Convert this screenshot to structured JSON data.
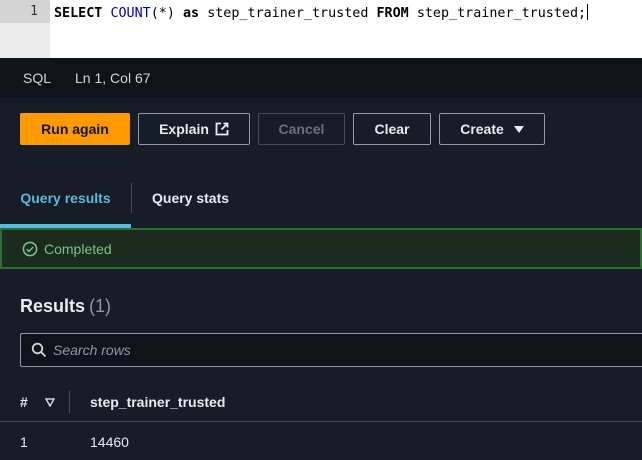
{
  "editor": {
    "line_number": "1",
    "tokens": {
      "select": "SELECT",
      "count_fn": "COUNT",
      "count_arg": "(*)",
      "as": "as",
      "alias": "step_trainer_trusted",
      "from": "FROM",
      "table": "step_trainer_trusted;"
    }
  },
  "statusbar": {
    "language": "SQL",
    "position": "Ln 1, Col 67"
  },
  "toolbar": {
    "run_again": "Run again",
    "explain": "Explain",
    "cancel": "Cancel",
    "clear": "Clear",
    "create": "Create"
  },
  "tabs": {
    "query_results": "Query results",
    "query_stats": "Query stats"
  },
  "status": {
    "text": "Completed",
    "color": "#7ec08a"
  },
  "results": {
    "title": "Results",
    "count": "(1)",
    "search_placeholder": "Search rows",
    "index_header": "#",
    "columns": [
      "step_trainer_trusted"
    ],
    "rows": [
      {
        "index": "1",
        "values": [
          "14460"
        ]
      }
    ]
  },
  "colors": {
    "accent_orange": "#ff9900",
    "tab_active": "#5ab8e0",
    "success_border": "#2c6e32"
  }
}
